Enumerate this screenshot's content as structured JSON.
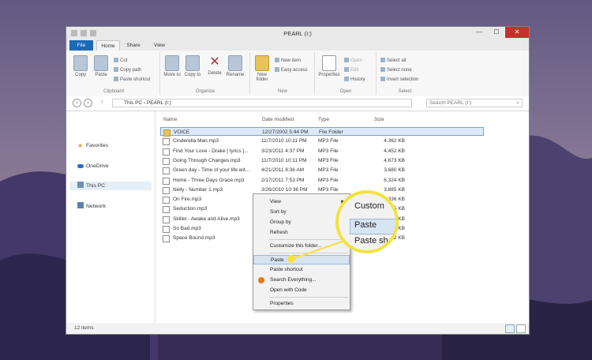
{
  "window": {
    "title": "PEARL (I:)",
    "controls": {
      "minimize": "—",
      "maximize": "☐",
      "close": "✕"
    }
  },
  "tabs": {
    "file": "File",
    "home": "Home",
    "share": "Share",
    "view": "View"
  },
  "ribbon": {
    "clipboard": {
      "label": "Clipboard",
      "copy": "Copy",
      "paste": "Paste",
      "cut": "Cut",
      "copy_path": "Copy path",
      "paste_shortcut": "Paste shortcut"
    },
    "organize": {
      "label": "Organize",
      "move_to": "Move to",
      "copy_to": "Copy to",
      "delete": "Delete",
      "rename": "Rename"
    },
    "new": {
      "label": "New",
      "new_folder": "New folder",
      "new_item": "New item",
      "easy_access": "Easy access"
    },
    "open": {
      "label": "Open",
      "properties": "Properties",
      "open": "Open",
      "edit": "Edit",
      "history": "History"
    },
    "select": {
      "label": "Select",
      "select_all": "Select all",
      "select_none": "Select none",
      "invert_selection": "Invert selection"
    }
  },
  "address": {
    "path": "This PC  ›  PEARL (I:)",
    "search_placeholder": "Search PEARL (I:)"
  },
  "nav": {
    "favorites": "Favorites",
    "onedrive": "OneDrive",
    "this_pc": "This PC",
    "network": "Network"
  },
  "columns": {
    "name": "Name",
    "date": "Date modified",
    "type": "Type",
    "size": "Size"
  },
  "files": [
    {
      "name": "VOICE",
      "date": "12/27/2002 5:44 PM",
      "type": "File Folder",
      "size": ""
    },
    {
      "name": "Cinderella Man.mp3",
      "date": "11/7/2010 10:11 PM",
      "type": "MP3 File",
      "size": "4,362 KB"
    },
    {
      "name": "Find Your Love - Drake [ lyrics ]...",
      "date": "3/23/2011 4:37 PM",
      "type": "MP3 File",
      "size": "4,452 KB"
    },
    {
      "name": "Going Through Changes.mp3",
      "date": "11/7/2010 10:11 PM",
      "type": "MP3 File",
      "size": "4,673 KB"
    },
    {
      "name": "Green day - Time of your life wit...",
      "date": "4/21/2011 8:36 AM",
      "type": "MP3 File",
      "size": "3,680 KB"
    },
    {
      "name": "Home - Three Days Grace.mp3",
      "date": "2/17/2011 7:53 PM",
      "type": "MP3 File",
      "size": "6,324 KB"
    },
    {
      "name": "Nelly - Number 1.mp3",
      "date": "3/26/2010 10:36 PM",
      "type": "MP3 File",
      "size": "3,885 KB"
    },
    {
      "name": "On Fire.mp3",
      "date": "",
      "type": "",
      "size": "4,336 KB"
    },
    {
      "name": "Seduction.mp3",
      "date": "",
      "type": "",
      "size": "305 KB"
    },
    {
      "name": "Skillet - Awake and Alive.mp3",
      "date": "",
      "type": "",
      "size": "361 KB"
    },
    {
      "name": "So Bad.mp3",
      "date": "",
      "type": "",
      "size": "35 KB"
    },
    {
      "name": "Space Bound.mp3",
      "date": "",
      "type": "",
      "size": "82 KB"
    }
  ],
  "status": {
    "items": "12 items"
  },
  "context_menu": {
    "view": "View",
    "sort_by": "Sort by",
    "group_by": "Group by",
    "refresh": "Refresh",
    "customize": "Customize this folder...",
    "paste": "Paste",
    "paste_shortcut": "Paste shortcut",
    "search_everything": "Search Everything...",
    "open_with_code": "Open with Code",
    "properties": "Properties"
  },
  "magnifier": {
    "item_top": "Custom",
    "item_paste": "Paste",
    "item_bottom": "Paste sh"
  },
  "colors": {
    "accent": "#1a6ab8",
    "highlight": "#f3e23e",
    "close": "#c9302c"
  }
}
